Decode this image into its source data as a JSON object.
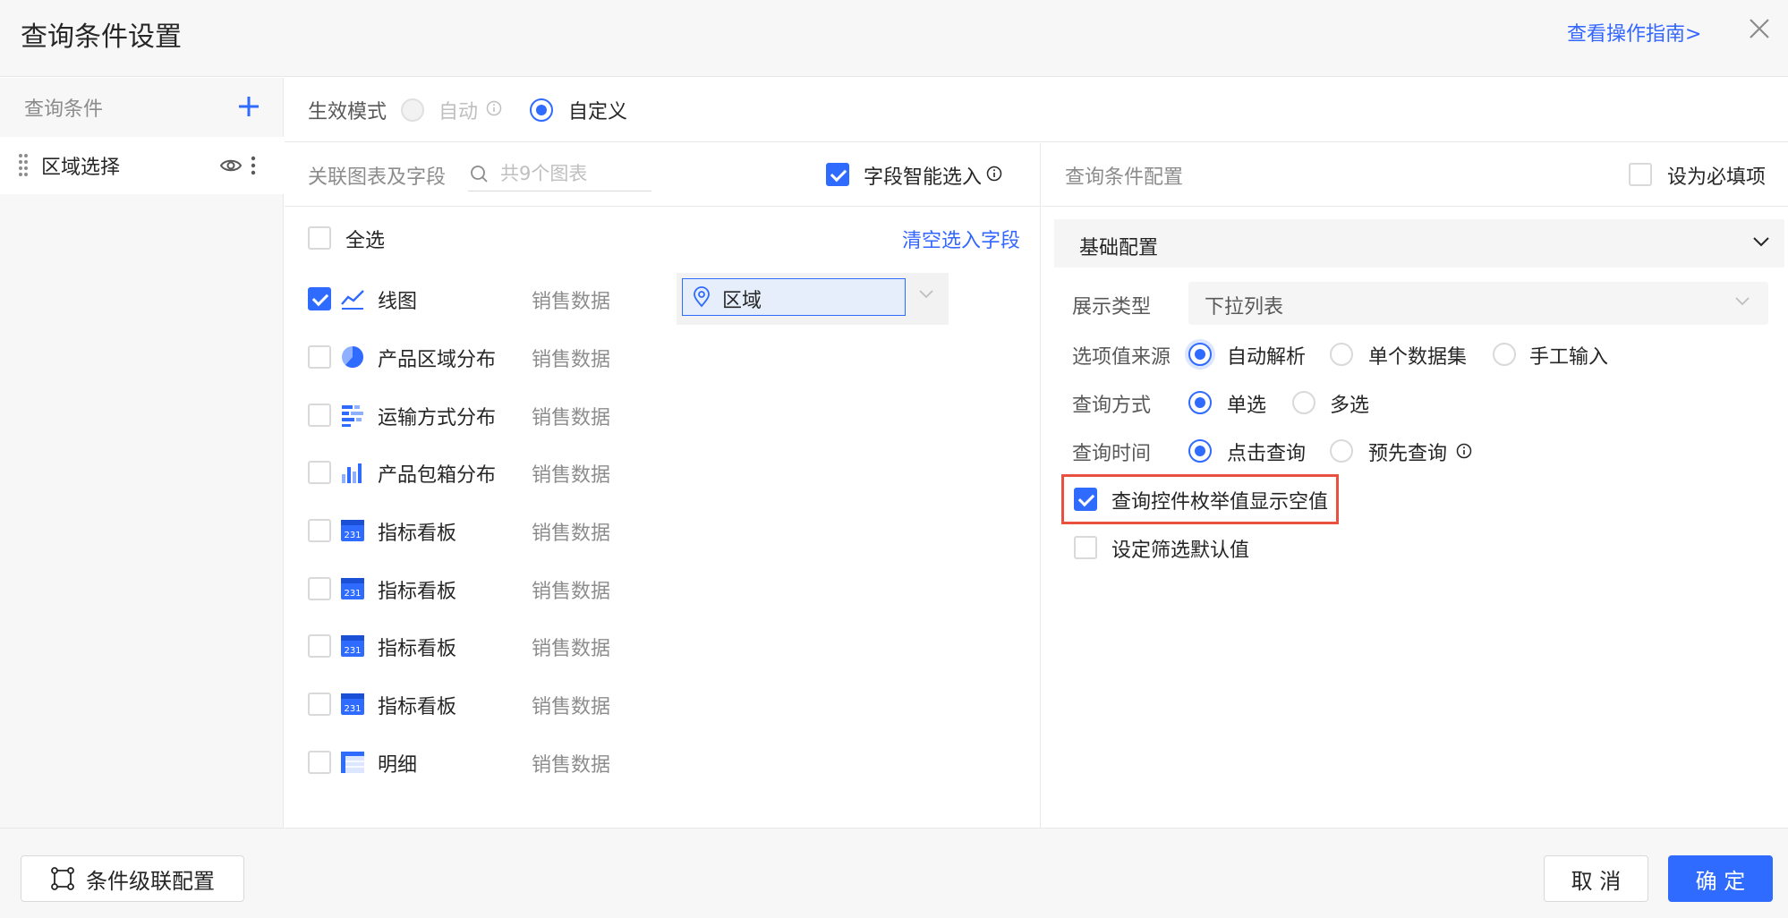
{
  "header": {
    "title": "查询条件设置",
    "guide_link": "查看操作指南>",
    "close_icon": "close-icon"
  },
  "sidebar": {
    "title": "查询条件",
    "add_icon": "plus-icon",
    "items": [
      {
        "label": "区域选择"
      }
    ]
  },
  "mode": {
    "label": "生效模式",
    "options": [
      {
        "label": "自动",
        "selected": false,
        "disabled": true
      },
      {
        "label": "自定义",
        "selected": true,
        "disabled": false
      }
    ]
  },
  "middle": {
    "label": "关联图表及字段",
    "search_placeholder": "共9个图表",
    "smart_select_label": "字段智能选入",
    "smart_select_checked": true,
    "select_all_label": "全选",
    "clear_link": "清空选入字段",
    "field_value": "区域",
    "rows": [
      {
        "name": "线图",
        "source": "销售数据",
        "checked": true,
        "icon": "line-chart-icon"
      },
      {
        "name": "产品区域分布",
        "source": "销售数据",
        "checked": false,
        "icon": "pie-chart-icon"
      },
      {
        "name": "运输方式分布",
        "source": "销售数据",
        "checked": false,
        "icon": "horizontal-bar-icon"
      },
      {
        "name": "产品包箱分布",
        "source": "销售数据",
        "checked": false,
        "icon": "bar-chart-icon"
      },
      {
        "name": "指标看板",
        "source": "销售数据",
        "checked": false,
        "icon": "kpi-board-icon"
      },
      {
        "name": "指标看板",
        "source": "销售数据",
        "checked": false,
        "icon": "kpi-board-icon"
      },
      {
        "name": "指标看板",
        "source": "销售数据",
        "checked": false,
        "icon": "kpi-board-icon"
      },
      {
        "name": "指标看板",
        "source": "销售数据",
        "checked": false,
        "icon": "kpi-board-icon"
      },
      {
        "name": "明细",
        "source": "销售数据",
        "checked": false,
        "icon": "table-icon"
      }
    ]
  },
  "right": {
    "label": "查询条件配置",
    "required_label": "设为必填项",
    "required_checked": false,
    "section_title": "基础配置",
    "display_type_label": "展示类型",
    "display_type_value": "下拉列表",
    "option_source_label": "选项值来源",
    "option_source_options": [
      "自动解析",
      "单个数据集",
      "手工输入"
    ],
    "query_mode_label": "查询方式",
    "query_mode_options": [
      "单选",
      "多选"
    ],
    "query_time_label": "查询时间",
    "query_time_options": [
      "点击查询",
      "预先查询"
    ],
    "show_empty_label": "查询控件枚举值显示空值",
    "show_empty_checked": true,
    "default_filter_label": "设定筛选默认值",
    "default_filter_checked": false
  },
  "footer": {
    "cascade_label": "条件级联配置",
    "cancel_label": "取 消",
    "ok_label": "确 定"
  },
  "colors": {
    "accent": "#2f6bff",
    "highlight": "#e8503f",
    "link": "#3366ff"
  }
}
